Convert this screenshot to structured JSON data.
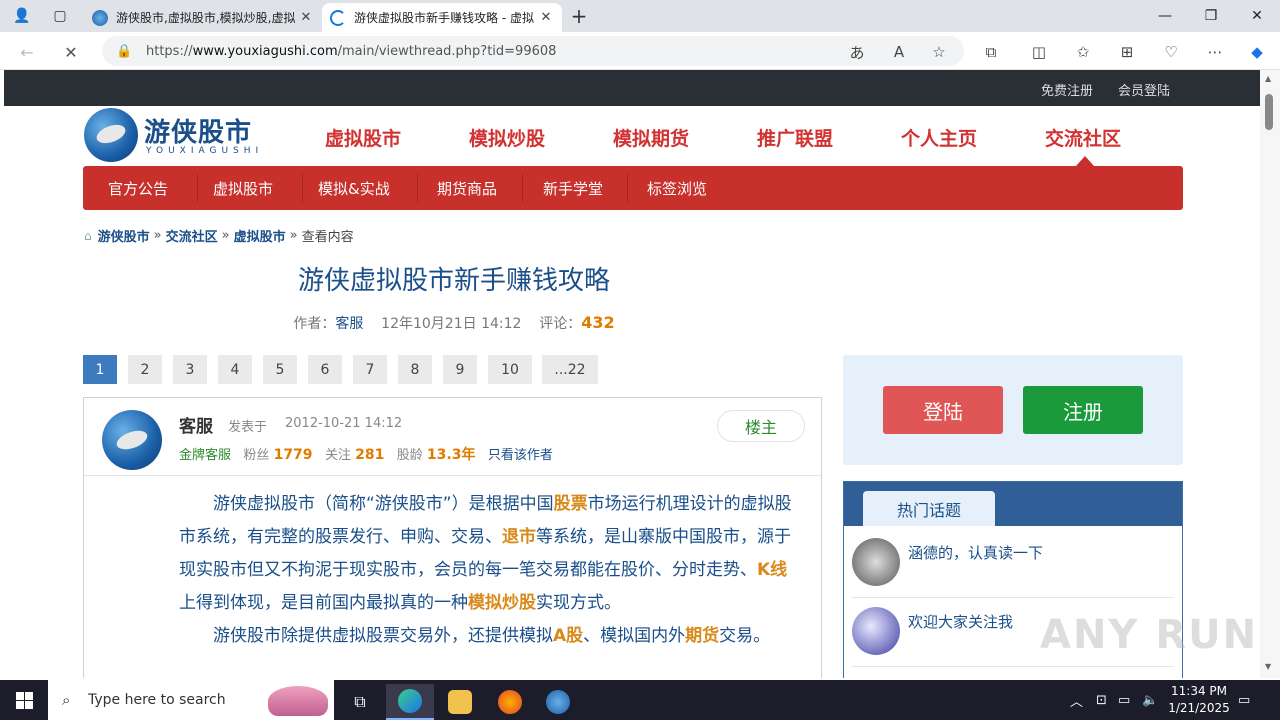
{
  "browser": {
    "tabs": [
      {
        "title": "游侠股市,虚拟股市,模拟炒股,虚拟"
      },
      {
        "title": "游侠虚拟股市新手赚钱攻略 - 虚拟"
      }
    ],
    "new_tab": "+",
    "close": "✕",
    "url_prefix": "https://",
    "url_domain": "www.youxiagushi.com",
    "url_path": "/main/viewthread.php?tid=99608"
  },
  "site": {
    "top_links": [
      "免费注册",
      "会员登陆"
    ],
    "logo_cn": "游侠股市",
    "logo_en": "YOUXIAGUSHI",
    "main_nav": [
      "虚拟股市",
      "模拟炒股",
      "模拟期货",
      "推广联盟",
      "个人主页",
      "交流社区"
    ],
    "sub_nav": [
      "官方公告",
      "虚拟股市",
      "模拟&实战",
      "期货商品",
      "新手学堂",
      "标签浏览"
    ],
    "breadcrumb": {
      "items": [
        "游侠股市",
        "交流社区",
        "虚拟股市"
      ],
      "current": "查看内容",
      "sep": "»"
    }
  },
  "article": {
    "title": "游侠虚拟股市新手赚钱攻略",
    "author_label": "作者：",
    "author": "客服",
    "date": "12年10月21日 14:12",
    "comment_label": "评论：",
    "comments": "432"
  },
  "pager": [
    "1",
    "2",
    "3",
    "4",
    "5",
    "6",
    "7",
    "8",
    "9",
    "10",
    "...22"
  ],
  "post": {
    "author": "客服",
    "posted_label": "发表于",
    "date": "2012-10-21 14:12",
    "badge": "金牌客服",
    "fans_label": "粉丝",
    "fans": "1779",
    "follow_label": "关注",
    "follow": "281",
    "age_label": "股龄",
    "age": "13.3年",
    "only_author": "只看该作者",
    "floor": "楼主",
    "p1_a": "游侠虚拟股市（简称“游侠股市”）是根据中国",
    "p1_k1": "股票",
    "p1_b": "市场运行机理设计的虚拟股市系统，有完整的股票发行、申购、交易、",
    "p1_k2": "退市",
    "p1_c": "等系统，是山寨版中国股市，源于现实股市但又不拘泥于现实股市，会员的每一笔交易都能在股价、分时走势、",
    "p1_k3": "K线",
    "p1_d": "上得到体现，是目前国内最拟真的一种",
    "p1_k4": "模拟炒股",
    "p1_e": "实现方式。",
    "p2_a": "游侠股市除提供虚拟股票交易外，还提供模拟",
    "p2_k1": "A股",
    "p2_b": "、模拟国内外",
    "p2_k2": "期货",
    "p2_c": "交易。"
  },
  "sidebar": {
    "login": "登陆",
    "register": "注册",
    "hot_title": "热门话题",
    "hot": [
      "涵德的，认真读一下",
      "欢迎大家关注我"
    ]
  },
  "watermark": "ANY RUN",
  "taskbar": {
    "search_placeholder": "Type here to search",
    "time": "11:34 PM",
    "date": "1/21/2025"
  },
  "colors": {
    "brand_red": "#c8302c",
    "link_blue": "#1a4f8a",
    "accent_orange": "#e07b00"
  }
}
